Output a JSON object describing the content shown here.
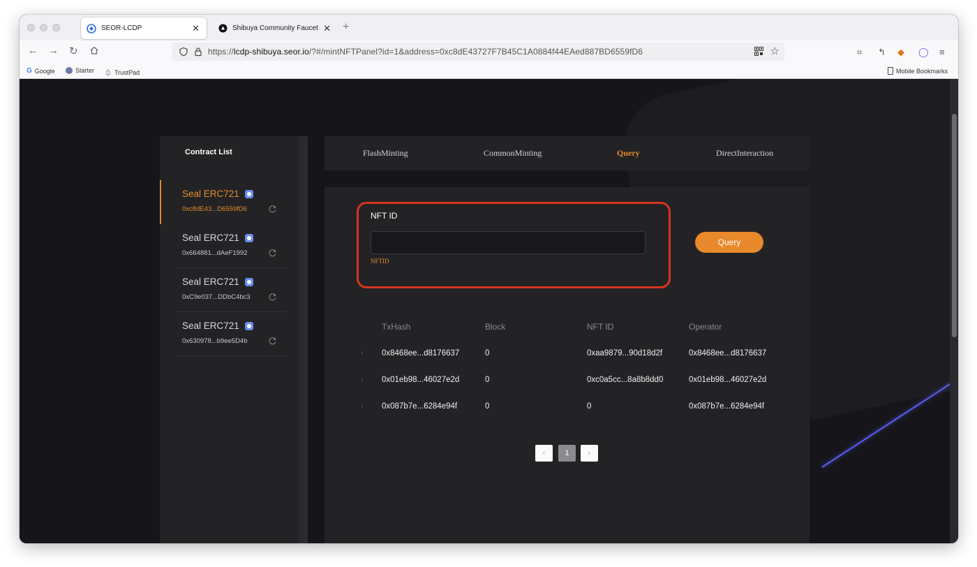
{
  "browser": {
    "tabs": [
      {
        "title": "SEOR-LCDP",
        "active": true
      },
      {
        "title": "Shibuya Community Faucet",
        "active": false
      }
    ],
    "url": {
      "prefix": "https://",
      "host": "lcdp-shibuya.seor.io",
      "path": "/?#/mintNFTPanel?id=1&address=0xc8dE43727F7B45C1A0884f44EAed887BD6559fD6"
    },
    "bookmarks": [
      "Google",
      "Starter",
      "TrustPad"
    ],
    "mobile_bookmarks": "Mobile Bookmarks"
  },
  "sidebar": {
    "title": "Contract List",
    "items": [
      {
        "name": "Seal ERC721",
        "address": "0xc8dE43...D6559fD6",
        "active": true
      },
      {
        "name": "Seal ERC721",
        "address": "0x664881...dAeF1992",
        "active": false
      },
      {
        "name": "Seal ERC721",
        "address": "0xC9e037...DDbC4bc3",
        "active": false
      },
      {
        "name": "Seal ERC721",
        "address": "0x630978...b9ee5D4b",
        "active": false
      }
    ]
  },
  "tabs": [
    "FlashMinting",
    "CommonMinting",
    "Query",
    "DirectInteraction"
  ],
  "active_tab": "Query",
  "form": {
    "label": "NFT ID",
    "input_value": "",
    "hint": "NFTID",
    "button": "Query"
  },
  "table": {
    "headers": [
      "TxHash",
      "Block",
      "NFT ID",
      "Operator"
    ],
    "rows": [
      [
        "0x8468ee...d8176637",
        "0",
        "0xaa9879...90d18d2f",
        "0x8468ee...d8176637"
      ],
      [
        "0x01eb98...46027e2d",
        "0",
        "0xc0a5cc...8a8b8dd0",
        "0x01eb98...46027e2d"
      ],
      [
        "0x087b7e...6284e94f",
        "0",
        "0",
        "0x087b7e...6284e94f"
      ]
    ]
  },
  "pagination": {
    "current": "1",
    "prev": "‹",
    "next": "›"
  },
  "colors": {
    "accent": "#e8892b",
    "highlight": "#d8331f",
    "panel": "#232326",
    "background": "#16161a"
  }
}
